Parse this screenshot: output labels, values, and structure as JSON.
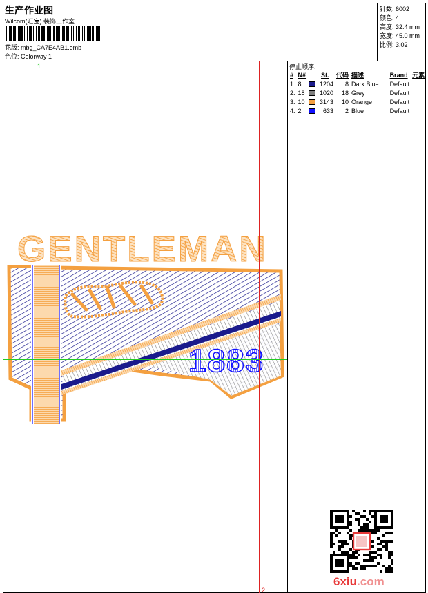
{
  "header": {
    "title": "生产作业图",
    "company": "Wilcom(汇宝) 装饰工作室",
    "design_label": "花版:",
    "design_file": "mbg_CA7E4AB1.emb",
    "color_label": "色位:",
    "colorway": "Colorway 1"
  },
  "stats": [
    {
      "label": "针数:",
      "value": "6002"
    },
    {
      "label": "颜色:",
      "value": "4"
    },
    {
      "label": "高度:",
      "value": "32.4 mm"
    },
    {
      "label": "宽度:",
      "value": "45.0 mm"
    },
    {
      "label": "比例:",
      "value": "3.02"
    }
  ],
  "stop_sequence": {
    "title": "停止顺序:",
    "columns": [
      "#",
      "N#",
      "St.",
      "代码",
      "描述",
      "Brand",
      "元素"
    ],
    "rows": [
      {
        "idx": "1.",
        "needle": "8",
        "color": "#1a1a8c",
        "stitches": "1204",
        "code": "8",
        "desc": "Dark Blue",
        "brand": "Default"
      },
      {
        "idx": "2.",
        "needle": "18",
        "color": "#808080",
        "stitches": "1020",
        "code": "18",
        "desc": "Grey",
        "brand": "Default"
      },
      {
        "idx": "3.",
        "needle": "10",
        "color": "#f4a040",
        "stitches": "3143",
        "code": "10",
        "desc": "Orange",
        "brand": "Default"
      },
      {
        "idx": "4.",
        "needle": "2",
        "color": "#1010ff",
        "stitches": "633",
        "code": "2",
        "desc": "Blue",
        "brand": "Default"
      }
    ]
  },
  "guides": {
    "label_1": "1",
    "label_2": "2",
    "green": "#22cc22",
    "red": "#dd2222"
  },
  "design": {
    "top_text": "GENTLEMAN",
    "year_text": "1883",
    "orange": "#f4a040",
    "blue": "#1010ff",
    "dark_blue": "#1a1a8c",
    "grey": "#808080"
  },
  "watermark": {
    "part1": "6xiu",
    "part2": ".com"
  }
}
